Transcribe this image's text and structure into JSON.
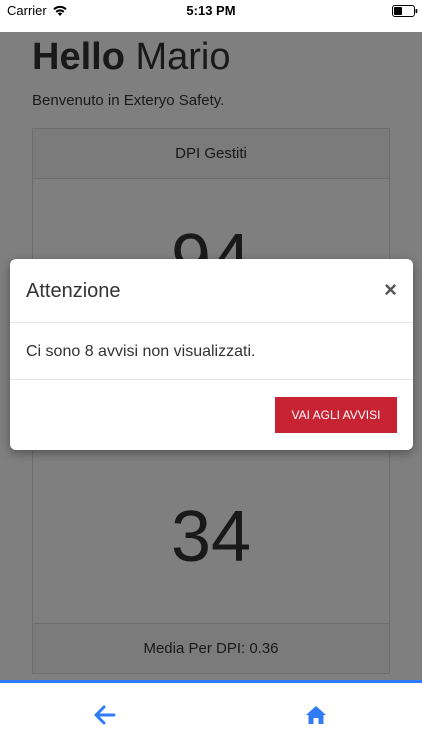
{
  "status_bar": {
    "carrier": "Carrier",
    "time": "5:13 PM"
  },
  "header": {
    "greeting_bold": "Hello",
    "greeting_name": "Mario",
    "welcome": "Benvenuto in Exteryo Safety."
  },
  "cards": [
    {
      "title": "DPI Gestiti",
      "value": "94"
    },
    {
      "value": "34",
      "footer": "Media Per DPI: 0.36"
    }
  ],
  "modal": {
    "title": "Attenzione",
    "close_symbol": "×",
    "message": "Ci sono 8 avvisi non visualizzati.",
    "button_label": "VAI AGLI AVVISI"
  },
  "nav": {
    "back_icon": "arrow-left-icon",
    "home_icon": "home-icon"
  },
  "colors": {
    "accent": "#2f7cf6",
    "danger": "#c82333",
    "backdrop": "rgba(0,0,0,0.5)"
  }
}
